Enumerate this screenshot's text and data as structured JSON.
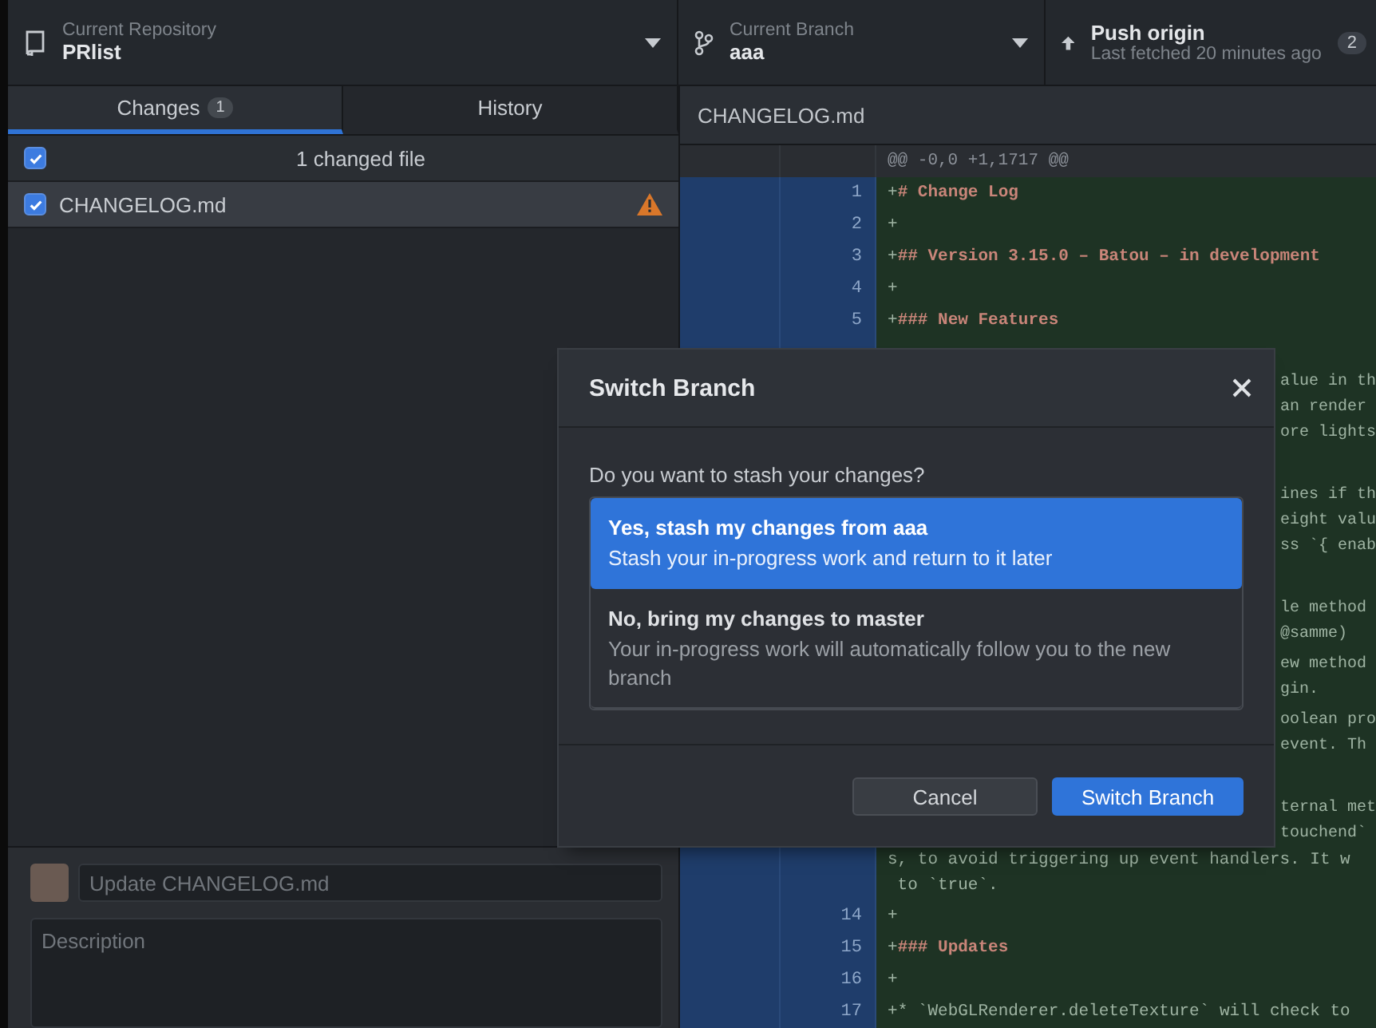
{
  "toolbar": {
    "repository": {
      "label": "Current Repository",
      "value": "PRlist"
    },
    "branch": {
      "label": "Current Branch",
      "value": "aaa"
    },
    "push": {
      "label": "Push origin",
      "detail": "Last fetched 20 minutes ago",
      "badge": "2"
    }
  },
  "tabs": [
    {
      "label": "Changes",
      "count": "1",
      "selected": true
    },
    {
      "label": "History",
      "selected": false
    }
  ],
  "changes": {
    "header": {
      "label": "1 changed file",
      "checked": true
    },
    "files": [
      {
        "name": "CHANGELOG.md",
        "checked": true,
        "selected": true,
        "warning": true
      }
    ]
  },
  "commit": {
    "summary": {
      "placeholder": "Update CHANGELOG.md"
    },
    "description": {
      "placeholder": "Description"
    }
  },
  "diff": {
    "file": "CHANGELOG.md",
    "hunk": "@@ -0,0 +1,1717 @@",
    "lines": [
      {
        "kind": "heading",
        "number": "1",
        "prefix": "+",
        "text": "# Change Log"
      },
      {
        "kind": "plain",
        "number": "2",
        "prefix": "+"
      },
      {
        "kind": "heading",
        "number": "3",
        "prefix": "+",
        "text": "## Version 3.15.0 – Batou – in development"
      },
      {
        "kind": "plain",
        "number": "4",
        "prefix": "+"
      },
      {
        "kind": "heading",
        "number": "5",
        "prefix": "+",
        "text": "### New Features"
      },
      {
        "kind": "hidden"
      },
      {
        "kind": "wrapped",
        "segments": [
          {
            "text": "alue in th",
            "clipped": true
          },
          {
            "text": "an render",
            "clipped": true
          },
          {
            "text": "ore lights",
            "clipped": true
          }
        ]
      },
      {
        "kind": "hidden"
      },
      {
        "kind": "wrapped",
        "segments": [
          {
            "text": "ines if th",
            "clipped": true
          },
          {
            "text": "eight valu",
            "clipped": true
          },
          {
            "text": "ss `{ enab",
            "clipped": true
          }
        ]
      },
      {
        "kind": "hidden"
      },
      {
        "kind": "wrapped",
        "segments": [
          {
            "text": "le method",
            "clipped": true
          },
          {
            "text": "@samme)",
            "clipped": true
          }
        ]
      },
      {
        "kind": "wrapped",
        "segments": [
          {
            "text": "ew method",
            "clipped": true
          },
          {
            "text": "gin.",
            "clipped": true
          }
        ]
      },
      {
        "kind": "wrapped",
        "segments": [
          {
            "text": "oolean pro",
            "clipped": true
          },
          {
            "text": "event. Th",
            "clipped": true
          }
        ]
      },
      {
        "kind": "hidden"
      },
      {
        "kind": "wrapped",
        "segments": [
          {
            "text": "ternal met",
            "clipped": true
          },
          {
            "text": "touchend`",
            "clipped": true
          },
          {
            "text": "s, to avoid triggering up event handlers. It w"
          },
          {
            "text": " to `true`."
          }
        ]
      },
      {
        "kind": "plain",
        "number": "14",
        "prefix": "+"
      },
      {
        "kind": "heading",
        "number": "15",
        "prefix": "+",
        "text": "### Updates"
      },
      {
        "kind": "plain",
        "number": "16",
        "prefix": "+"
      },
      {
        "kind": "plain",
        "number": "17",
        "prefix": "+",
        "text": "* `WebGLRenderer.deleteTexture` will check to"
      }
    ]
  },
  "dialog": {
    "title": "Switch Branch",
    "question": "Do you want to stash your changes?",
    "options": [
      {
        "title": "Yes, stash my changes from aaa",
        "description": "Stash your in-progress work and return to it later",
        "selected": true
      },
      {
        "title": "No, bring my changes to master",
        "description": "Your in-progress work will automatically follow you to the new branch",
        "selected": false
      }
    ],
    "buttons": [
      {
        "label": "Cancel",
        "kind": "secondary"
      },
      {
        "label": "Switch Branch",
        "kind": "primary"
      }
    ]
  }
}
